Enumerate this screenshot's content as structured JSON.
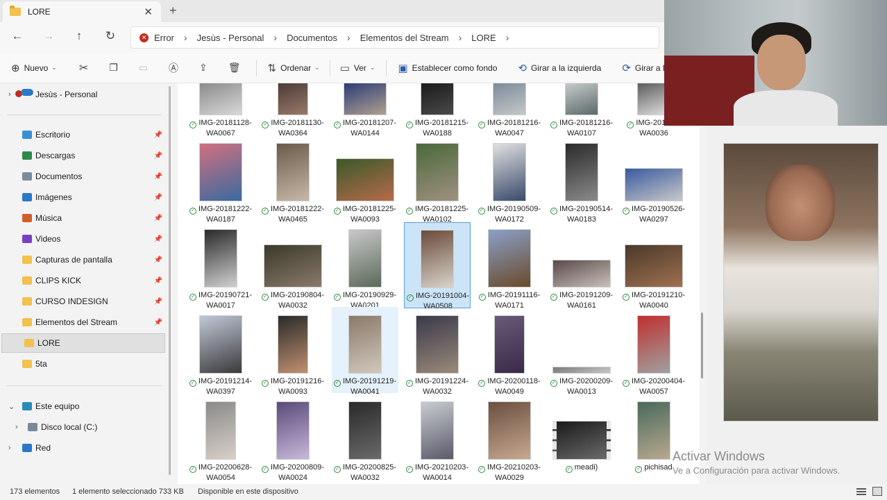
{
  "window": {
    "tab_title": "LORE",
    "tab_close": "✕",
    "new_tab": "+"
  },
  "nav": {
    "back": "←",
    "forward": "→",
    "up": "↑",
    "refresh": "↻"
  },
  "breadcrumb": {
    "error_label": "Error",
    "items": [
      "Jesùs - Personal",
      "Documentos",
      "Elementos del Stream",
      "LORE"
    ],
    "sep": "›"
  },
  "commands": {
    "new_label": "Nuevo",
    "sort_label": "Ordenar",
    "view_label": "Ver",
    "set_background": "Establecer como fondo",
    "rotate_left": "Girar a la izquierda",
    "rotate_right": "Girar a la"
  },
  "sidebar": {
    "account": "Jesùs - Personal",
    "quick_access": [
      {
        "label": "Escritorio",
        "color": "#3a8fd6"
      },
      {
        "label": "Descargas",
        "color": "#2f8a4a"
      },
      {
        "label": "Documentos",
        "color": "#7a8aa0"
      },
      {
        "label": "Imágenes",
        "color": "#2a78c8"
      },
      {
        "label": "Música",
        "color": "#d0602a"
      },
      {
        "label": "Videos",
        "color": "#7b3fc4"
      },
      {
        "label": "Capturas de pantalla",
        "color": "#f2c14e"
      },
      {
        "label": "CLIPS KICK",
        "color": "#f2c14e"
      },
      {
        "label": "CURSO INDESIGN",
        "color": "#f2c14e"
      },
      {
        "label": "Elementos del Stream",
        "color": "#f2c14e"
      },
      {
        "label": "LORE",
        "color": "#f2c14e"
      },
      {
        "label": "5ta",
        "color": "#f2c14e"
      }
    ],
    "this_pc": "Este equipo",
    "local_disk": "Disco local (C:)",
    "network": "Red"
  },
  "files": [
    {
      "l1": "IMG-20181128-",
      "l2": "WA0067",
      "w": 62,
      "h": 48,
      "c1": "#8a8a8a",
      "c2": "#d8d8d8"
    },
    {
      "l1": "IMG-20181130-",
      "l2": "WA0364",
      "w": 44,
      "h": 48,
      "c1": "#4a3a36",
      "c2": "#9a7a6a"
    },
    {
      "l1": "IMG-20181207-",
      "l2": "WA0144",
      "w": 62,
      "h": 48,
      "c1": "#2c3a78",
      "c2": "#b0a090"
    },
    {
      "l1": "IMG-20181215-",
      "l2": "WA0188",
      "w": 48,
      "h": 48,
      "c1": "#1a1a1a",
      "c2": "#4a4a4a"
    },
    {
      "l1": "IMG-20181216-",
      "l2": "WA0047",
      "w": 48,
      "h": 48,
      "c1": "#7a8a9a",
      "c2": "#c4c8c8"
    },
    {
      "l1": "IMG-20181216-",
      "l2": "WA0107",
      "w": 48,
      "h": 48,
      "c1": "#c8cccc",
      "c2": "#5a6a6a"
    },
    {
      "l1": "IMG-20181...",
      "l2": "WA0036",
      "w": 48,
      "h": 48,
      "c1": "#5a5a5a",
      "c2": "#e0e0e0"
    },
    {
      "l1": "IMG-20181222-",
      "l2": "WA0187",
      "w": 62,
      "h": 84,
      "c1": "#d07080",
      "c2": "#3a6aa0"
    },
    {
      "l1": "IMG-20181222-",
      "l2": "WA0465",
      "w": 48,
      "h": 84,
      "c1": "#6a5a4a",
      "c2": "#c8b8a8"
    },
    {
      "l1": "IMG-20181225-",
      "l2": "WA0093",
      "w": 84,
      "h": 62,
      "c1": "#3a5a2a",
      "c2": "#b86a4a"
    },
    {
      "l1": "IMG-20181225-",
      "l2": "WA0102",
      "w": 62,
      "h": 84,
      "c1": "#4a6a3a",
      "c2": "#a09080"
    },
    {
      "l1": "IMG-20190509-",
      "l2": "WA0172",
      "w": 48,
      "h": 84,
      "c1": "#e0e0e0",
      "c2": "#3a4a6a"
    },
    {
      "l1": "IMG-20190514-",
      "l2": "WA0183",
      "w": 48,
      "h": 84,
      "c1": "#2a2a2a",
      "c2": "#8a8a8a"
    },
    {
      "l1": "IMG-20190526-",
      "l2": "WA0297",
      "w": 84,
      "h": 48,
      "c1": "#3a5aa0",
      "c2": "#c8c8c8"
    },
    {
      "l1": "IMG-20190721-",
      "l2": "WA0017",
      "w": 48,
      "h": 84,
      "c1": "#2a2a2a",
      "c2": "#d0d0d0"
    },
    {
      "l1": "IMG-20190804-",
      "l2": "WA0032",
      "w": 84,
      "h": 62,
      "c1": "#3a3a2a",
      "c2": "#8a7a6a"
    },
    {
      "l1": "IMG-20190929-",
      "l2": "WA0201",
      "w": 48,
      "h": 84,
      "c1": "#c8c8c8",
      "c2": "#5a6a5a"
    },
    {
      "l1": "IMG-20191004-",
      "l2": "WA0508",
      "w": 48,
      "h": 84,
      "c1": "#6a4a3a",
      "c2": "#d8d4cc"
    },
    {
      "l1": "IMG-20191116-",
      "l2": "WA0171",
      "w": 62,
      "h": 84,
      "c1": "#8aa0c8",
      "c2": "#6a4a2a"
    },
    {
      "l1": "IMG-20191209-",
      "l2": "WA0161",
      "w": 84,
      "h": 40,
      "c1": "#5a4a4a",
      "c2": "#c8c0b8"
    },
    {
      "l1": "IMG-20191210-",
      "l2": "WA0040",
      "w": 84,
      "h": 62,
      "c1": "#4a3a2a",
      "c2": "#a07050"
    },
    {
      "l1": "IMG-20191214-",
      "l2": "WA0397",
      "w": 62,
      "h": 84,
      "c1": "#c0c8d8",
      "c2": "#3a3a3a"
    },
    {
      "l1": "IMG-20191216-",
      "l2": "WA0093",
      "w": 44,
      "h": 84,
      "c1": "#2a2a2a",
      "c2": "#c09070"
    },
    {
      "l1": "IMG-20191219-",
      "l2": "WA0041",
      "w": 48,
      "h": 84,
      "c1": "#8a7a6a",
      "c2": "#d0c8bc"
    },
    {
      "l1": "IMG-20191224-",
      "l2": "WA0032",
      "w": 62,
      "h": 84,
      "c1": "#3a3a4a",
      "c2": "#9a8a7a"
    },
    {
      "l1": "IMG-20200118-",
      "l2": "WA0049",
      "w": 44,
      "h": 84,
      "c1": "#6a5a7a",
      "c2": "#3a2a4a"
    },
    {
      "l1": "IMG-20200209-",
      "l2": "WA0013",
      "w": 84,
      "h": 10,
      "c1": "#7a7a7a",
      "c2": "#c8c8c8"
    },
    {
      "l1": "IMG-20200404-",
      "l2": "WA0057",
      "w": 48,
      "h": 84,
      "c1": "#c03030",
      "c2": "#a0a0a0"
    },
    {
      "l1": "IMG-20200628-",
      "l2": "WA0054",
      "w": 44,
      "h": 84,
      "c1": "#8a8a8a",
      "c2": "#d8d0c8"
    },
    {
      "l1": "IMG-20200809-",
      "l2": "WA0024",
      "w": 48,
      "h": 84,
      "c1": "#5a4a7a",
      "c2": "#c8b8d8"
    },
    {
      "l1": "IMG-20200825-",
      "l2": "WA0032",
      "w": 48,
      "h": 84,
      "c1": "#2a2a2a",
      "c2": "#6a6a6a"
    },
    {
      "l1": "IMG-20210203-",
      "l2": "WA0014",
      "w": 48,
      "h": 84,
      "c1": "#c8ccd0",
      "c2": "#5a5a6a"
    },
    {
      "l1": "IMG-20210203-",
      "l2": "WA0029",
      "w": 62,
      "h": 84,
      "c1": "#6a5040",
      "c2": "#c8a890"
    },
    {
      "l1": "meadi)",
      "l2": "",
      "w": 84,
      "h": 56,
      "c1": "#1a1a1a",
      "c2": "#6a6a6a"
    },
    {
      "l1": "pichisad",
      "l2": "",
      "w": 48,
      "h": 84,
      "c1": "#4a6a5a",
      "c2": "#b8a890"
    }
  ],
  "watermark": {
    "title": "Activar Windows",
    "subtitle": "Ve a Configuración para activar Windows."
  },
  "status": {
    "count": "173 elementos",
    "selected": "1 elemento seleccionado  733 KB",
    "availability": "Disponible en este dispositivo"
  },
  "colors": {
    "accent": "#2a5ea8",
    "selection": "#cce4f7",
    "selection_border": "#5a9bd5",
    "error": "#c42b1c",
    "sync_ok": "#2d8a3e"
  }
}
